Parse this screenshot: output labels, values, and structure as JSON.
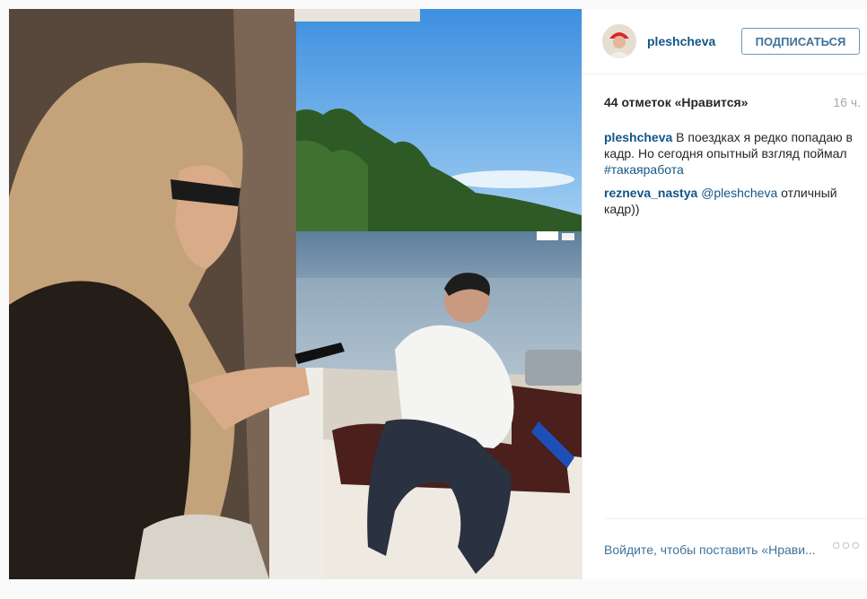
{
  "post": {
    "author": "pleshcheva",
    "follow_label": "ПОДПИСАТЬСЯ",
    "likes": "44 отметок «Нравится»",
    "time": "16 ч.",
    "caption_user": "pleshcheva",
    "caption_text": "В поездках я редко попадаю в кадр. Но сегодня опытный взгляд поймал",
    "caption_tag": "#такаяработа",
    "comment_user": "rezneva_nastya",
    "comment_mention": "@pleshcheva",
    "comment_text": "отличный кадр))",
    "login_prompt": "Войдите, чтобы поставить «Нрави...",
    "more_label": "○○○"
  },
  "colors": {
    "link": "#125688",
    "button_text": "#3f729b",
    "muted": "#a5a7aa"
  }
}
